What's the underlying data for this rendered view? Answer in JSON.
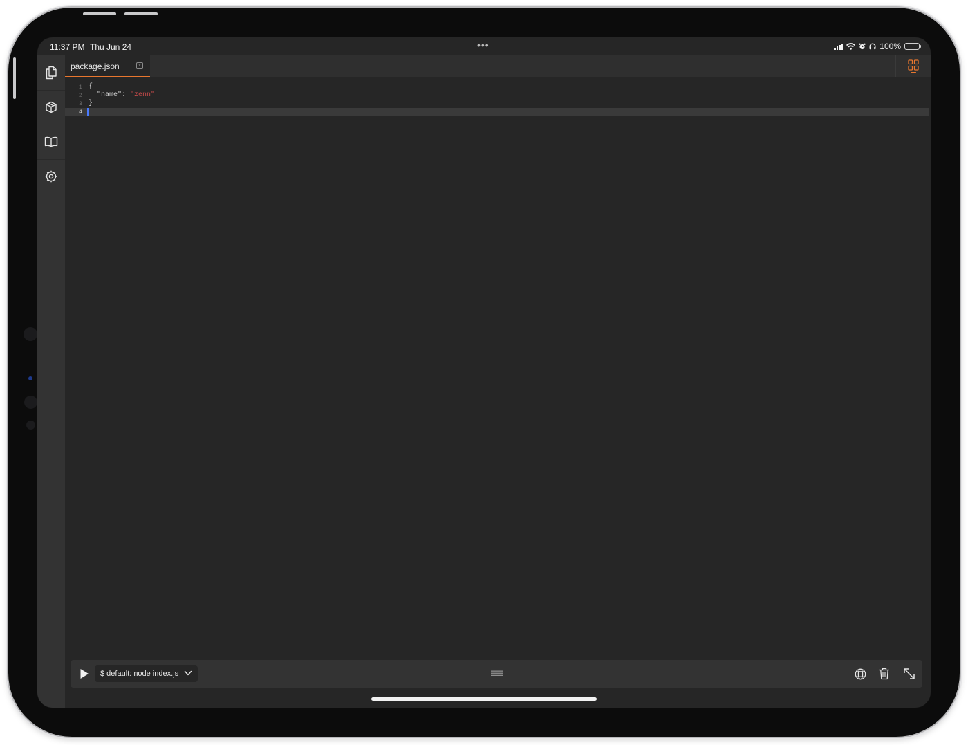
{
  "status_bar": {
    "time": "11:37 PM",
    "date": "Thu Jun 24",
    "multitask_dots": "•••",
    "battery_percent": "100%",
    "battery_level": 1.0,
    "battery_charging": true,
    "signal_icon": "cellular-signal-icon",
    "wifi_icon": "wifi-icon",
    "alarm_icon": "alarm-icon",
    "headphones_icon": "headphones-icon"
  },
  "sidebar": {
    "items": [
      {
        "icon": "files-icon"
      },
      {
        "icon": "package-icon"
      },
      {
        "icon": "book-icon"
      },
      {
        "icon": "settings-icon"
      }
    ]
  },
  "tabs": [
    {
      "label": "package.json",
      "active": true,
      "close_glyph": "×"
    }
  ],
  "editor": {
    "lines": [
      {
        "number": "1",
        "text": "{"
      },
      {
        "number": "2",
        "key": "\"name\"",
        "sep": ": ",
        "value": "\"zenn\""
      },
      {
        "number": "3",
        "text": "}"
      },
      {
        "number": "4",
        "text": ""
      }
    ],
    "active_line": 4
  },
  "console": {
    "script_label": "$ default: node index.js"
  },
  "colors": {
    "accent": "#e8762e",
    "background": "#262626",
    "sidebar": "#333333",
    "string": "#c94b4b",
    "cursor": "#4a7bff",
    "battery": "#30d158"
  }
}
